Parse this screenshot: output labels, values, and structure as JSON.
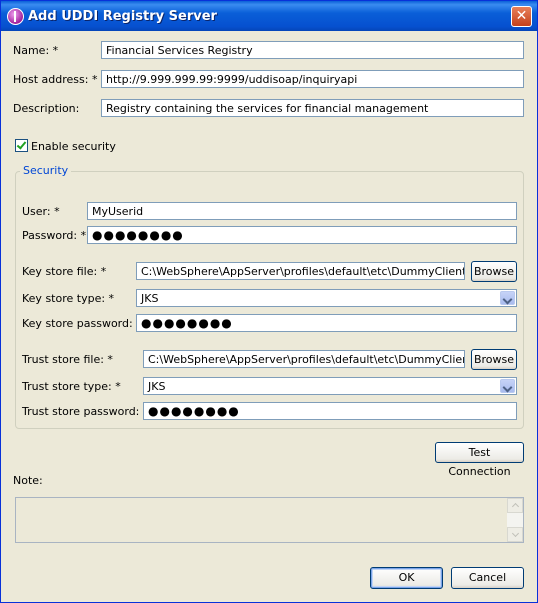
{
  "window": {
    "title": "Add UDDI Registry Server",
    "close_glyph": "✕",
    "icon": "app-icon"
  },
  "form": {
    "name_label": "Name: *",
    "name_value": "Financial Services Registry",
    "host_label": "Host address: *",
    "host_value": "http://9.999.999.99:9999/uddisoap/inquiryapi",
    "description_label": "Description:",
    "description_value": "Registry containing the services for financial management",
    "enable_security_label": "Enable security",
    "enable_security_checked": true
  },
  "security": {
    "group_title": "Security",
    "user_label": "User: *",
    "user_value": "MyUserid",
    "password_label": "Password: *",
    "password_value": "●●●●●●●●",
    "key_store_file_label": "Key store file: *",
    "key_store_file_value": "C:\\WebSphere\\AppServer\\profiles\\default\\etc\\DummyClientKeyFile",
    "key_store_browse": "Browse",
    "key_store_type_label": "Key store type: *",
    "key_store_type_value": "JKS",
    "key_store_password_label": "Key store password: *",
    "key_store_password_value": "●●●●●●●●",
    "trust_store_file_label": "Trust store file: *",
    "trust_store_file_value": "C:\\WebSphere\\AppServer\\profiles\\default\\etc\\DummyClientTrust",
    "trust_store_browse": "Browse",
    "trust_store_type_label": "Trust store type: *",
    "trust_store_type_value": "JKS",
    "trust_store_password_label": "Trust store password: *",
    "trust_store_password_value": "●●●●●●●●"
  },
  "actions": {
    "test_connection": "Test Connection",
    "note_label": "Note:",
    "note_value": "",
    "ok": "OK",
    "cancel": "Cancel"
  }
}
